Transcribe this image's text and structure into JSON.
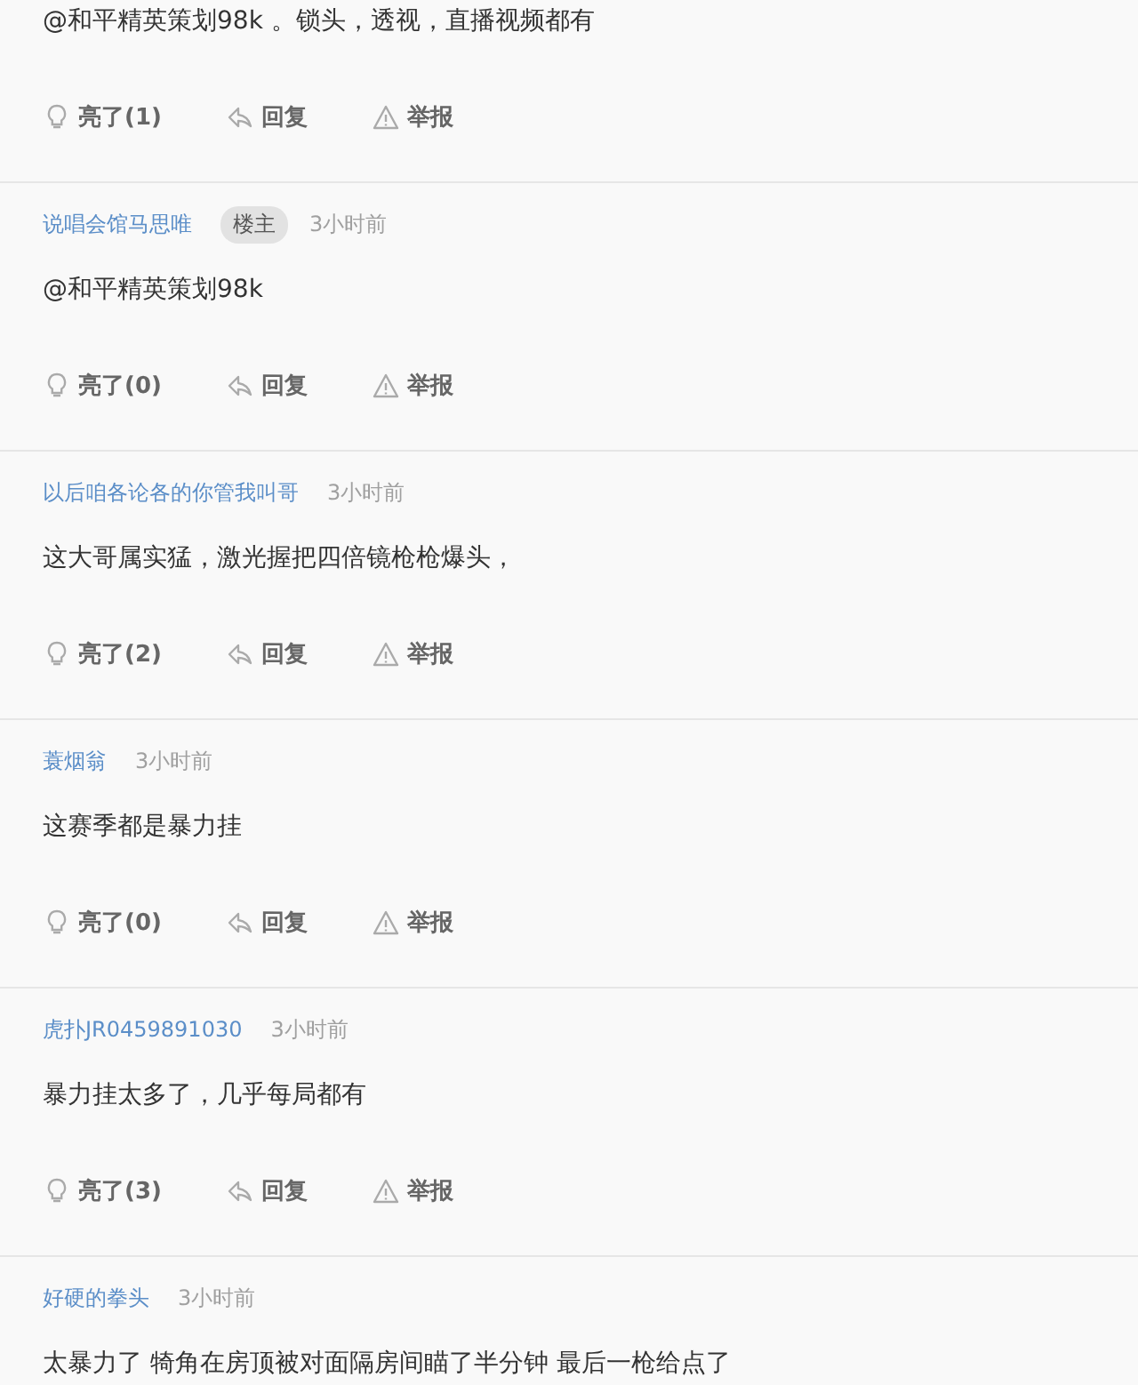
{
  "comments": [
    {
      "text": "@和平精英策划98k 。锁头，透视，直播视频都有",
      "actions": {
        "like": "亮了(1)",
        "reply": "回复",
        "report": "举报"
      }
    },
    {
      "author": "说唱会馆马思唯",
      "badge": "楼主",
      "time": "3小时前",
      "text": "@和平精英策划98k",
      "actions": {
        "like": "亮了(0)",
        "reply": "回复",
        "report": "举报"
      }
    },
    {
      "author": "以后咱各论各的你管我叫哥",
      "time": "3小时前",
      "text": "这大哥属实猛，激光握把四倍镜枪枪爆头，",
      "actions": {
        "like": "亮了(2)",
        "reply": "回复",
        "report": "举报"
      }
    },
    {
      "author": "蓑烟翁",
      "time": "3小时前",
      "text": "这赛季都是暴力挂",
      "actions": {
        "like": "亮了(0)",
        "reply": "回复",
        "report": "举报"
      }
    },
    {
      "author": "虎扑JR0459891030",
      "time": "3小时前",
      "text": "暴力挂太多了，几乎每局都有",
      "actions": {
        "like": "亮了(3)",
        "reply": "回复",
        "report": "举报"
      }
    },
    {
      "author": "好硬的拳头",
      "time": "3小时前",
      "text": "太暴力了 犄角在房顶被对面隔房间瞄了半分钟 最后一枪给点了"
    }
  ]
}
